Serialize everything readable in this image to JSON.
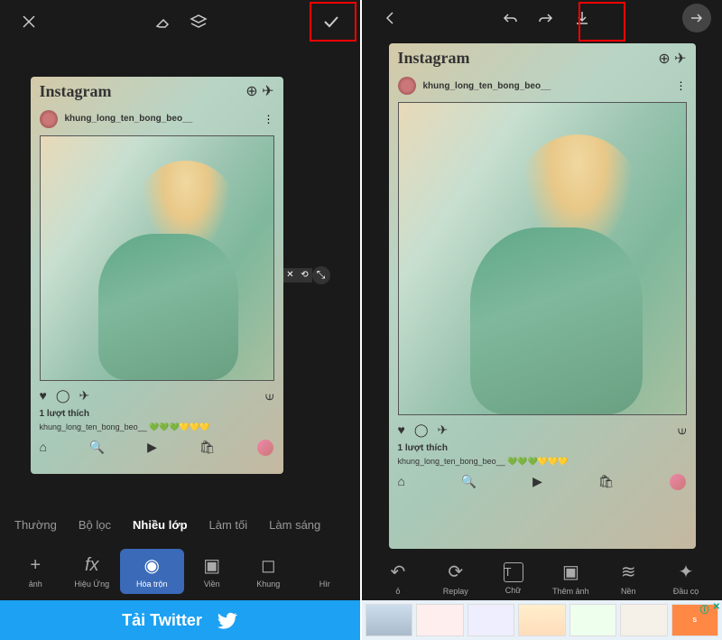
{
  "left": {
    "post": {
      "logo": "Instagram",
      "username": "khung_long_ten_bong_beo__",
      "likes": "1 lượt thích",
      "caption_user": "khung_long_ten_bong_beo__",
      "hearts": "💚💚💚💛💛💛"
    },
    "tabs": [
      "Thường",
      "Bộ lọc",
      "Nhiều lớp",
      "Làm tối",
      "Làm sáng"
    ],
    "active_tab": 2,
    "tools": [
      {
        "icon": "+",
        "label": "ảnh"
      },
      {
        "icon": "fx",
        "label": "Hiệu Ứng"
      },
      {
        "icon": "◉",
        "label": "Hòa trộn"
      },
      {
        "icon": "▣",
        "label": "Viền"
      },
      {
        "icon": "◻",
        "label": "Khung"
      },
      {
        "icon": "",
        "label": "Hìr"
      }
    ],
    "active_tool": 2,
    "ad": "Tải Twitter"
  },
  "right": {
    "post": {
      "logo": "Instagram",
      "username": "khung_long_ten_bong_beo__",
      "likes": "1 lượt thích",
      "caption_user": "khung_long_ten_bong_beo__",
      "hearts": "💚💚💚💛💛💛"
    },
    "tools": [
      {
        "icon": "↶",
        "label": "ỏ"
      },
      {
        "icon": "⟳",
        "label": "Replay"
      },
      {
        "icon": "T",
        "label": "Chữ"
      },
      {
        "icon": "▣",
        "label": "Thêm ảnh"
      },
      {
        "icon": "≋",
        "label": "Nền"
      },
      {
        "icon": "✦",
        "label": "Đầu cọ"
      }
    ]
  }
}
